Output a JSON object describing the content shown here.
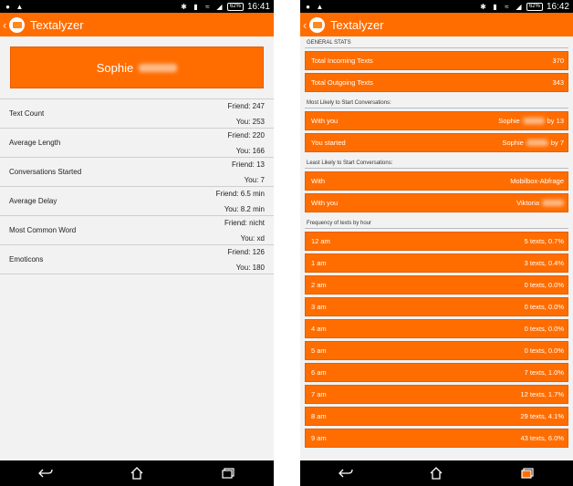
{
  "left_phone": {
    "status": {
      "battery": "62%",
      "time": "16:41"
    },
    "app_title": "Textalyzer",
    "contact_name": "Sophie",
    "stats": [
      {
        "label": "Text Count",
        "friend": "Friend: 247",
        "you": "You: 253"
      },
      {
        "label": "Average Length",
        "friend": "Friend: 220",
        "you": "You: 166"
      },
      {
        "label": "Conversations Started",
        "friend": "Friend: 13",
        "you": "You: 7"
      },
      {
        "label": "Average Delay",
        "friend": "Friend: 6.5 min",
        "you": "You: 8.2 min"
      },
      {
        "label": "Most Common Word",
        "friend": "Friend: nicht",
        "you": "You: xd"
      },
      {
        "label": "Emoticons",
        "friend": "Friend: 126",
        "you": "You: 180"
      }
    ]
  },
  "right_phone": {
    "status": {
      "battery": "62%",
      "time": "16:42"
    },
    "app_title": "Textalyzer",
    "general_stats_header": "GENERAL STATS",
    "general_stats": [
      {
        "label": "Total Incoming Texts",
        "value": "370"
      },
      {
        "label": "Total Outgoing Texts",
        "value": "343"
      }
    ],
    "most_likely_header": "Most Likely to Start Conversations:",
    "most_likely": [
      {
        "label": "With you",
        "name": "Sophie",
        "suffix": "by 13"
      },
      {
        "label": "You started",
        "name": "Sophie",
        "suffix": "by 7"
      }
    ],
    "least_likely_header": "Least Likely to Start Conversations:",
    "least_likely": [
      {
        "label": "With",
        "name": "Mobilbox-Abfrage",
        "suffix": ""
      },
      {
        "label": "With you",
        "name": "Viktoria",
        "suffix": ""
      }
    ],
    "frequency_header": "Frequency of texts by hour",
    "frequency": [
      {
        "hour": "12 am",
        "value": "5 texts, 0.7%"
      },
      {
        "hour": "1 am",
        "value": "3 texts, 0.4%"
      },
      {
        "hour": "2 am",
        "value": "0 texts, 0.0%"
      },
      {
        "hour": "3 am",
        "value": "0 texts, 0.0%"
      },
      {
        "hour": "4 am",
        "value": "0 texts, 0.0%"
      },
      {
        "hour": "5 am",
        "value": "0 texts, 0.0%"
      },
      {
        "hour": "6 am",
        "value": "7 texts, 1.0%"
      },
      {
        "hour": "7 am",
        "value": "12 texts, 1.7%"
      },
      {
        "hour": "8 am",
        "value": "29 texts, 4.1%"
      },
      {
        "hour": "9 am",
        "value": "43 texts, 6.0%"
      }
    ]
  },
  "colors": {
    "accent": "#ff6d00",
    "statusbar": "#000000",
    "background": "#f2f2f2"
  },
  "icons": {
    "back": "chevron-left-icon",
    "app": "envelope-icon",
    "nav": [
      "back-icon",
      "home-icon",
      "recents-icon"
    ]
  }
}
